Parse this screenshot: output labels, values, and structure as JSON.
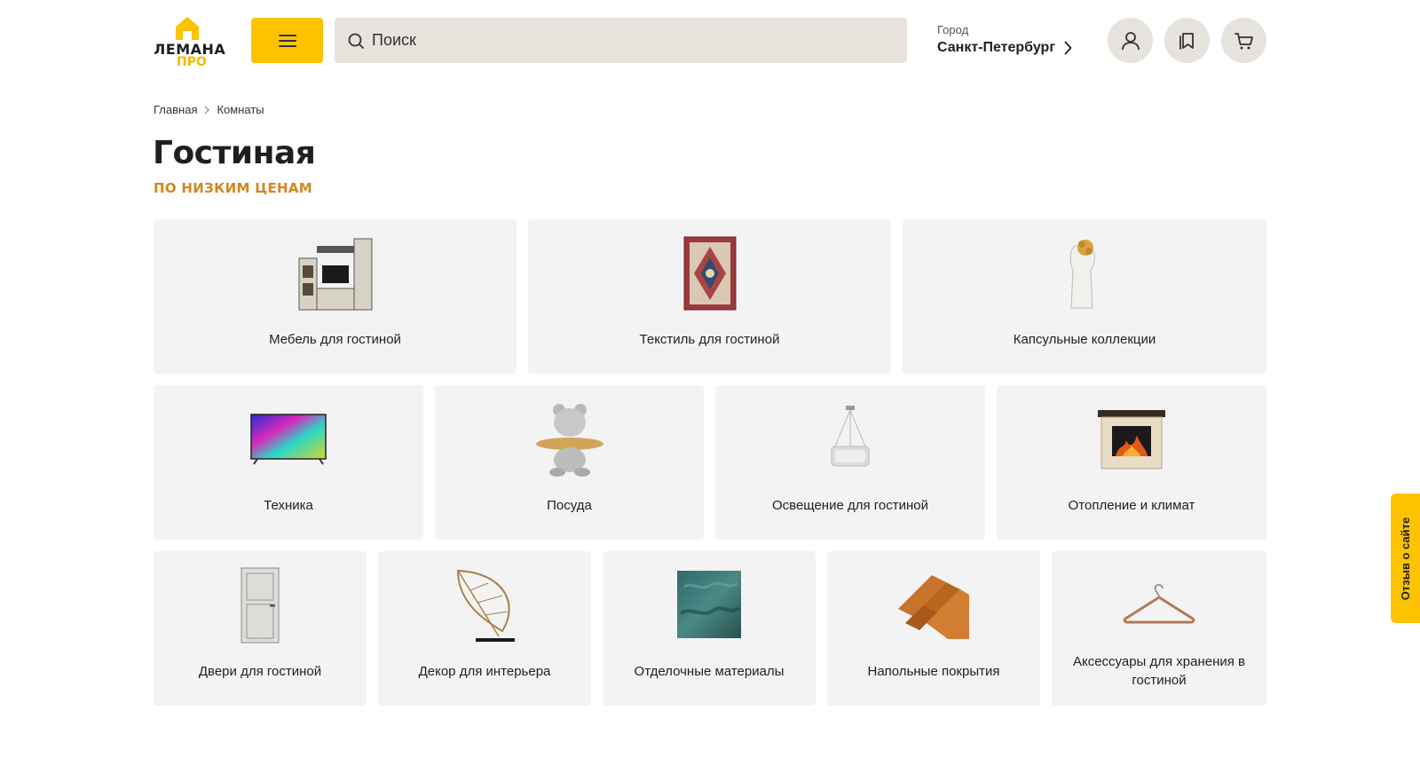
{
  "header": {
    "logo_line1": "ЛЕМАНА",
    "logo_line2": "ПРО",
    "search_placeholder": "Поиск",
    "city_label": "Город",
    "city_value": "Санкт-Петербург"
  },
  "breadcrumb": [
    "Главная",
    "Комнаты"
  ],
  "page": {
    "title": "Гостиная",
    "subtitle": "ПО НИЗКИМ ЦЕНАМ"
  },
  "categories": [
    {
      "label": "Мебель для гостиной",
      "icon": "tv-wall-unit-icon"
    },
    {
      "label": "Текстиль для гостиной",
      "icon": "rug-icon"
    },
    {
      "label": "Капсульные коллекции",
      "icon": "vase-sculpture-icon"
    },
    {
      "label": "Техника",
      "icon": "tv-icon"
    },
    {
      "label": "Посуда",
      "icon": "bear-tray-icon"
    },
    {
      "label": "Освещение для гостиной",
      "icon": "chandelier-icon"
    },
    {
      "label": "Отопление и климат",
      "icon": "fireplace-icon"
    },
    {
      "label": "Двери для гостиной",
      "icon": "door-icon"
    },
    {
      "label": "Декор для интерьера",
      "icon": "leaf-decor-icon"
    },
    {
      "label": "Отделочные материалы",
      "icon": "wallpaper-icon"
    },
    {
      "label": "Напольные покрытия",
      "icon": "parquet-icon"
    },
    {
      "label": "Аксессуары для хранения в гостиной",
      "icon": "hanger-icon"
    }
  ],
  "feedback_label": "Отзыв о сайте",
  "colors": {
    "accent": "#fdc300",
    "subtitle": "#d4861f",
    "tile_bg": "#f3f3f3",
    "search_bg": "#e6e3dc"
  }
}
